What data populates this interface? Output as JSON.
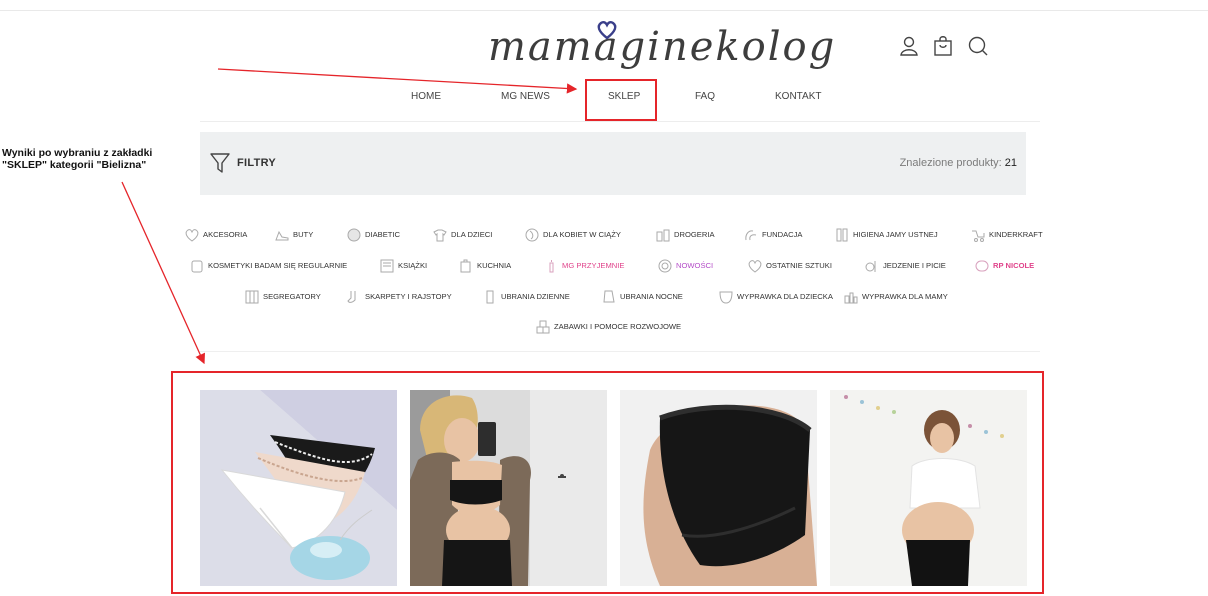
{
  "logo": {
    "text": "mamaginekolog"
  },
  "header_icons": [
    "user-icon",
    "bag-icon",
    "search-icon"
  ],
  "nav": {
    "items": [
      "HOME",
      "MG NEWS",
      "SKLEP",
      "FAQ",
      "KONTAKT"
    ],
    "highlighted": "SKLEP"
  },
  "filter_bar": {
    "label": "FILTRY",
    "found_label": "Znalezione produkty:",
    "found_count": "21"
  },
  "annotation": {
    "text": "Wyniki po wybraniu z zakładki \"SKLEP\" kategorii \"Bielizna\"",
    "color": "#e5252a"
  },
  "categories": [
    {
      "label": "AKCESORIA",
      "icon": "heart-outline-icon"
    },
    {
      "label": "BUTY",
      "icon": "shoe-icon"
    },
    {
      "label": "DIABETIC",
      "icon": "circle-badge-icon"
    },
    {
      "label": "DLA DZIECI",
      "icon": "baby-shirt-icon"
    },
    {
      "label": "DLA KOBIET W CIĄŻY",
      "icon": "pregnancy-icon"
    },
    {
      "label": "DROGERIA",
      "icon": "bottles-icon"
    },
    {
      "label": "FUNDACJA",
      "icon": "hands-icon"
    },
    {
      "label": "HIGIENA JAMY USTNEJ",
      "icon": "toothbrush-icon"
    },
    {
      "label": "KINDERKRAFT",
      "icon": "stroller-icon"
    },
    {
      "label": "KOSMETYKI BADAM SIĘ REGULARNIE",
      "icon": "cosmetics-icon"
    },
    {
      "label": "KSIĄŻKI",
      "icon": "book-icon"
    },
    {
      "label": "KUCHNIA",
      "icon": "cup-icon"
    },
    {
      "label": "MG PRZYJEMNIE",
      "icon": "candle-icon",
      "color": "pink"
    },
    {
      "label": "NOWOŚCI",
      "icon": "new-badge-icon",
      "color": "purple"
    },
    {
      "label": "OSTATNIE SZTUKI",
      "icon": "heart-outline-icon"
    },
    {
      "label": "JEDZENIE I PICIE",
      "icon": "food-icon"
    },
    {
      "label": "RP NICOLE",
      "icon": "rp-logo-icon",
      "color": "pink-bold"
    },
    {
      "label": "SEGREGATORY",
      "icon": "binder-icon"
    },
    {
      "label": "SKARPETY I RAJSTOPY",
      "icon": "sock-icon"
    },
    {
      "label": "UBRANIA DZIENNE",
      "icon": "sleeve-icon"
    },
    {
      "label": "UBRANIA NOCNE",
      "icon": "nightwear-icon"
    },
    {
      "label": "WYPRAWKA DLA DZIECKA",
      "icon": "bib-icon"
    },
    {
      "label": "WYPRAWKA DLA MAMY",
      "icon": "bottles-group-icon"
    },
    {
      "label": "ZABAWKI I POMOCE ROZWOJOWE",
      "icon": "blocks-icon"
    }
  ],
  "products": [
    {
      "alt": "white-and-lace-underwear-photo"
    },
    {
      "alt": "pregnant-woman-mirror-selfie-photo"
    },
    {
      "alt": "black-maternity-briefs-photo"
    },
    {
      "alt": "pregnant-woman-white-tshirt-photo"
    }
  ],
  "colors": {
    "accent": "#e5252a",
    "pink": "#e0438b",
    "purple": "#b44cc8",
    "filter_bg": "#eef0f1"
  }
}
